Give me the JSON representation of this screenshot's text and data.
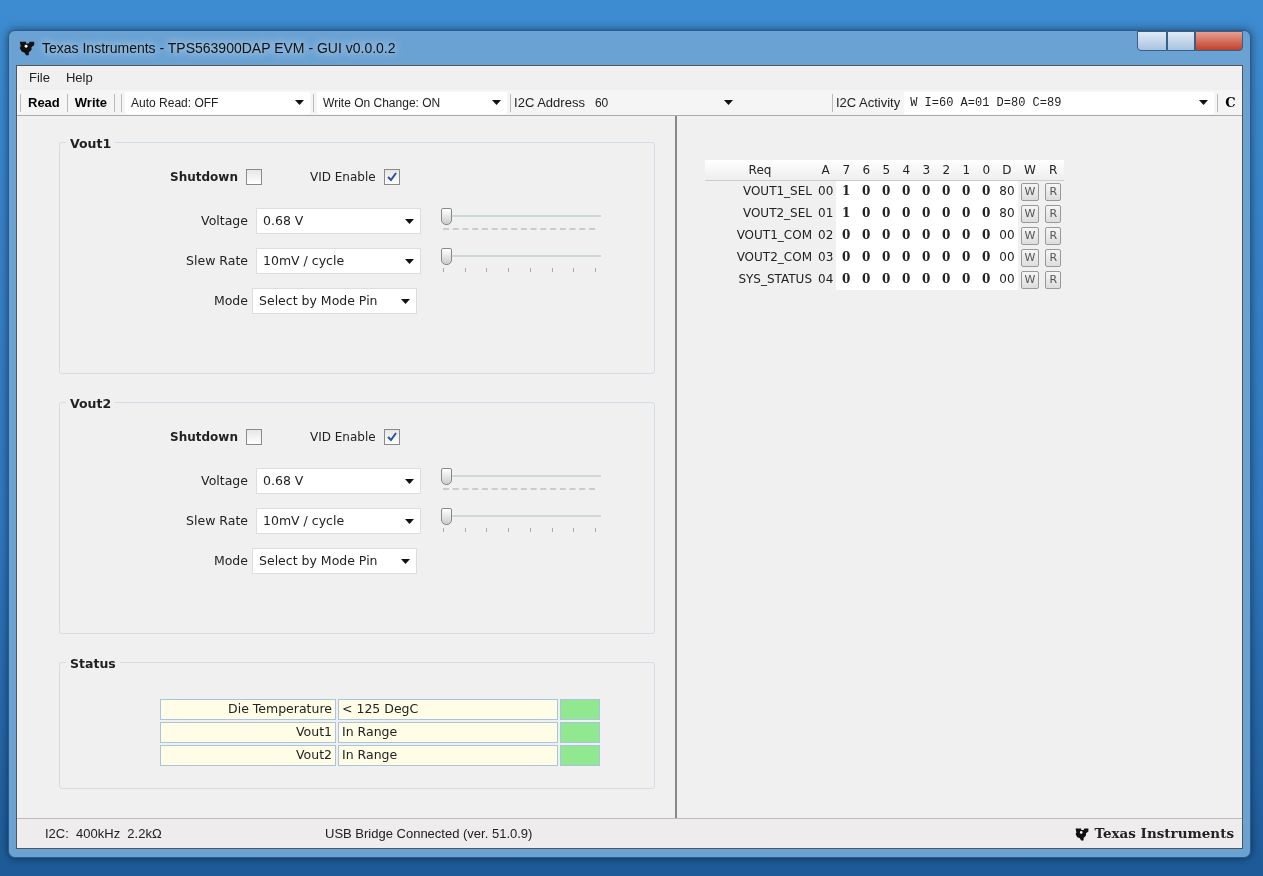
{
  "window": {
    "title": "Texas Instruments - TPS563900DAP EVM - GUI v0.0.0.2"
  },
  "menu": [
    "File",
    "Help"
  ],
  "toolbar": {
    "read": "Read",
    "write": "Write",
    "auto_read": "Auto Read: OFF",
    "write_on_change": "Write On Change: ON",
    "i2c_address_label": "I2C Address",
    "i2c_address": "60",
    "i2c_activity_label": "I2C Activity",
    "i2c_activity": "W I=60 A=01 D=80 C=89",
    "clear": "C"
  },
  "groups": [
    {
      "title": "Vout1",
      "shutdown_label": "Shutdown",
      "shutdown_checked": false,
      "vid_label": "VID Enable",
      "vid_checked": true,
      "rows": [
        {
          "label": "Voltage",
          "value": "0.68 V",
          "slider": {
            "level": 0,
            "kind": "fine"
          }
        },
        {
          "label": "Slew Rate",
          "value": "10mV / cycle",
          "slider": {
            "level": 0,
            "kind": "coarse"
          }
        },
        {
          "label": "Mode",
          "value": "Select by Mode Pin"
        }
      ]
    },
    {
      "title": "Vout2",
      "shutdown_label": "Shutdown",
      "shutdown_checked": false,
      "vid_label": "VID Enable",
      "vid_checked": true,
      "rows": [
        {
          "label": "Voltage",
          "value": "0.68 V",
          "slider": {
            "level": 0,
            "kind": "fine"
          }
        },
        {
          "label": "Slew Rate",
          "value": "10mV / cycle",
          "slider": {
            "level": 0,
            "kind": "coarse"
          }
        },
        {
          "label": "Mode",
          "value": "Select by Mode Pin"
        }
      ]
    }
  ],
  "status": {
    "title": "Status",
    "rows": [
      {
        "label": "Die Temperature",
        "value": "< 125 DegC",
        "color": "#90e890"
      },
      {
        "label": "Vout1",
        "value": "In Range",
        "color": "#90e890"
      },
      {
        "label": "Vout2",
        "value": "In Range",
        "color": "#90e890"
      }
    ]
  },
  "registers": {
    "columns": [
      "Req",
      "A",
      "7",
      "6",
      "5",
      "4",
      "3",
      "2",
      "1",
      "0",
      "D",
      "W",
      "R"
    ],
    "rows": [
      {
        "name": "VOUT1_SEL",
        "addr": "00",
        "bits": [
          "1",
          "0",
          "0",
          "0",
          "0",
          "0",
          "0",
          "0"
        ],
        "data": "80",
        "w": "W",
        "r": "R"
      },
      {
        "name": "VOUT2_SEL",
        "addr": "01",
        "bits": [
          "1",
          "0",
          "0",
          "0",
          "0",
          "0",
          "0",
          "0"
        ],
        "data": "80",
        "w": "W",
        "r": "R"
      },
      {
        "name": "VOUT1_COM",
        "addr": "02",
        "bits": [
          "0",
          "0",
          "0",
          "0",
          "0",
          "0",
          "0",
          "0"
        ],
        "data": "00",
        "w": "W",
        "r": "R"
      },
      {
        "name": "VOUT2_COM",
        "addr": "03",
        "bits": [
          "0",
          "0",
          "0",
          "0",
          "0",
          "0",
          "0",
          "0"
        ],
        "data": "00",
        "w": "W",
        "r": "R"
      },
      {
        "name": "SYS_STATUS",
        "addr": "04",
        "bits": [
          "0",
          "0",
          "0",
          "0",
          "0",
          "0",
          "0",
          "0"
        ],
        "data": "00",
        "w": "W",
        "r": "R"
      }
    ]
  },
  "status_bar": {
    "left": "I2C:  400kHz  2.2kΩ",
    "center": "USB Bridge Connected (ver. 51.0.9)",
    "brand": "Texas Instruments"
  }
}
